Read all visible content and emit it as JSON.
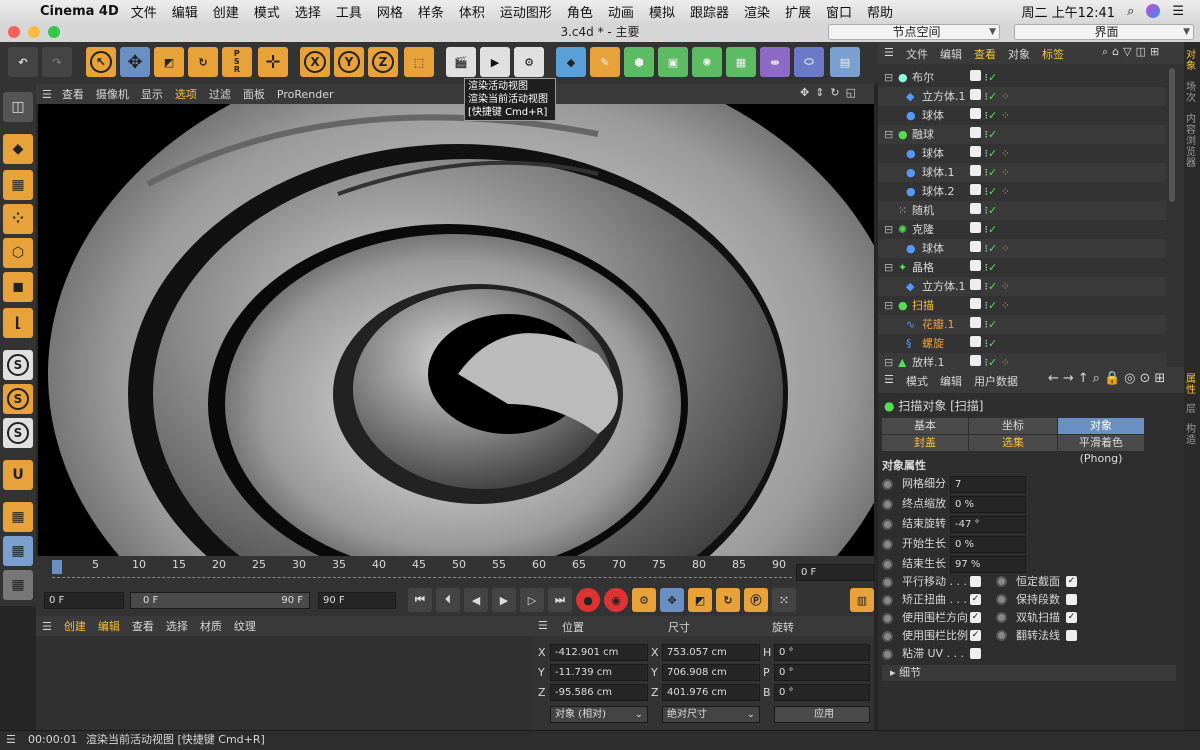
{
  "menubar": {
    "app": "Cinema 4D",
    "items": [
      "文件",
      "编辑",
      "创建",
      "模式",
      "选择",
      "工具",
      "网格",
      "样条",
      "体积",
      "运动图形",
      "角色",
      "动画",
      "模拟",
      "跟踪器",
      "渲染",
      "扩展",
      "窗口",
      "帮助"
    ],
    "clock": "周二 上午12:41"
  },
  "titlebar": {
    "title": "3.c4d * - 主要",
    "layout_a": "节点空间",
    "layout_b": "界面"
  },
  "tooltip": {
    "line1": "渲染活动视图",
    "line2": "渲染当前活动视图",
    "line3": "[快捷键 Cmd+R]"
  },
  "viewport_menu": [
    "查看",
    "摄像机",
    "显示",
    "选项",
    "过滤",
    "面板",
    "ProRender"
  ],
  "timeline": {
    "ticks": [
      "0",
      "5",
      "10",
      "15",
      "20",
      "25",
      "30",
      "35",
      "40",
      "45",
      "50",
      "55",
      "60",
      "65",
      "70",
      "75",
      "80",
      "85",
      "90"
    ],
    "current": "0 F",
    "start": "0 F",
    "min": "0 F",
    "max": "90 F",
    "end": "90 F"
  },
  "material_menu": [
    "创建",
    "编辑",
    "查看",
    "选择",
    "材质",
    "纹理"
  ],
  "coords": {
    "headers": [
      "位置",
      "尺寸",
      "旋转"
    ],
    "rows": [
      {
        "axis": "X",
        "pos": "-412.901 cm",
        "saxis": "X",
        "size": "753.057 cm",
        "raxis": "H",
        "rot": "0 °"
      },
      {
        "axis": "Y",
        "pos": "-11.739 cm",
        "saxis": "Y",
        "size": "706.908 cm",
        "raxis": "P",
        "rot": "0 °"
      },
      {
        "axis": "Z",
        "pos": "-95.586 cm",
        "saxis": "Z",
        "size": "401.976 cm",
        "raxis": "B",
        "rot": "0 °"
      }
    ],
    "mode": "对象 (相对)",
    "size_mode": "绝对尺寸",
    "apply": "应用"
  },
  "status": {
    "time": "00:00:01",
    "text": "渲染当前活动视图 [快捷键 Cmd+R]"
  },
  "objman": {
    "menu": [
      "文件",
      "编辑",
      "查看",
      "对象",
      "标签"
    ],
    "objects": [
      {
        "name": "布尔",
        "indent": 0,
        "tag": false,
        "color": "#ffffff"
      },
      {
        "name": "立方体.1",
        "indent": 1,
        "tag": true,
        "color": "#ffffff"
      },
      {
        "name": "球体",
        "indent": 1,
        "tag": true,
        "color": "#ffffff"
      },
      {
        "name": "融球",
        "indent": 0,
        "tag": false,
        "color": "#ffffff"
      },
      {
        "name": "球体",
        "indent": 1,
        "tag": true,
        "color": "#ffffff"
      },
      {
        "name": "球体.1",
        "indent": 1,
        "tag": true,
        "color": "#ffffff"
      },
      {
        "name": "球体.2",
        "indent": 1,
        "tag": true,
        "color": "#ffffff"
      },
      {
        "name": "随机",
        "indent": 0,
        "tag": false,
        "color": "#ffffff"
      },
      {
        "name": "克隆",
        "indent": 0,
        "tag": false,
        "color": "#ffffff"
      },
      {
        "name": "球体",
        "indent": 1,
        "tag": true,
        "color": "#ffffff"
      },
      {
        "name": "晶格",
        "indent": 0,
        "tag": false,
        "color": "#ffffff"
      },
      {
        "name": "立方体.1",
        "indent": 1,
        "tag": true,
        "color": "#ffffff"
      },
      {
        "name": "扫描",
        "indent": 0,
        "tag": true,
        "color": "#f5c03b"
      },
      {
        "name": "花瓣.1",
        "indent": 1,
        "tag": false,
        "color": "#e8a23a"
      },
      {
        "name": "螺旋",
        "indent": 1,
        "tag": false,
        "color": "#e8a23a"
      },
      {
        "name": "放样.1",
        "indent": 0,
        "tag": true,
        "color": "#ffffff"
      }
    ]
  },
  "attr": {
    "menu": [
      "模式",
      "编辑",
      "用户数据"
    ],
    "title": "扫描对象 [扫描]",
    "tabs1": [
      "基本",
      "坐标",
      "对象"
    ],
    "tabs2": [
      "封盖",
      "选集",
      "平滑着色(Phong)"
    ],
    "section": "对象属性",
    "props": [
      {
        "label": "网格细分",
        "value": "7"
      },
      {
        "label": "终点缩放",
        "value": "0 %"
      },
      {
        "label": "结束旋转",
        "value": "-47 °"
      },
      {
        "label": "开始生长",
        "value": "0 %"
      },
      {
        "label": "结束生长",
        "value": "97 %"
      }
    ],
    "checks": [
      {
        "l": "平行移动 . . .",
        "lv": "",
        "r": "恒定截面",
        "rv": "✓"
      },
      {
        "l": "矫正扭曲 . . .",
        "lv": "✓",
        "r": "保持段数",
        "rv": ""
      },
      {
        "l": "使用围栏方向",
        "lv": "✓",
        "r": "双轨扫描",
        "rv": "✓"
      },
      {
        "l": "使用围栏比例",
        "lv": "✓",
        "r": "翻转法线",
        "rv": ""
      },
      {
        "l": "粘滞 UV . . .",
        "lv": "",
        "r": "",
        "rv": ""
      }
    ],
    "detail": "细节"
  },
  "sidetabs_top": [
    "对象",
    "场次",
    "内容浏览器"
  ],
  "sidetabs_bottom": [
    "属性",
    "层",
    "构造"
  ]
}
